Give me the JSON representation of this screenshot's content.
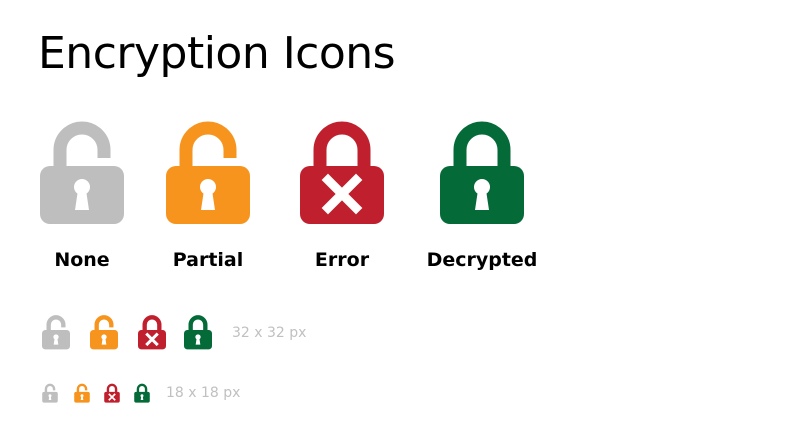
{
  "title": "Encryption Icons",
  "colors": {
    "none": "#bebebe",
    "partial": "#f7941d",
    "error": "#c0202e",
    "decrypted": "#046a38",
    "hole": "#ffffff",
    "size_label": "#c0c0c0"
  },
  "icons": [
    {
      "key": "none",
      "label": "None",
      "state": "unlocked",
      "glyph": "keyhole-icon"
    },
    {
      "key": "partial",
      "label": "Partial",
      "state": "unlocked",
      "glyph": "keyhole-icon"
    },
    {
      "key": "error",
      "label": "Error",
      "state": "locked",
      "glyph": "x-mark-icon"
    },
    {
      "key": "decrypted",
      "label": "Decrypted",
      "state": "locked",
      "glyph": "keyhole-icon"
    }
  ],
  "sizes": [
    {
      "label": "32 x 32 px"
    },
    {
      "label": "18 x 18 px"
    }
  ]
}
